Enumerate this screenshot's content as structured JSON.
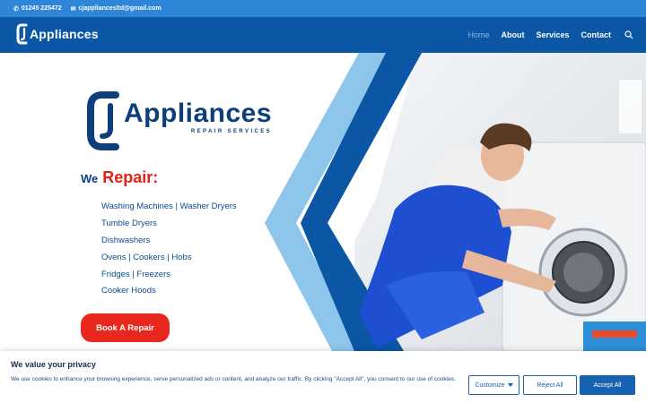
{
  "topbar": {
    "phone": "01245 225472",
    "email": "cjappliancesltd@gmail.com"
  },
  "header": {
    "logo_text": "Appliances",
    "nav": [
      {
        "label": "Home",
        "active": true
      },
      {
        "label": "About",
        "active": false
      },
      {
        "label": "Services",
        "active": false
      },
      {
        "label": "Contact",
        "active": false
      }
    ]
  },
  "hero": {
    "logo_name": "Appliances",
    "logo_tagline": "REPAIR SERVICES",
    "we": "We",
    "repair": "Repair:",
    "services": [
      "Washing Machines | Washer Dryers",
      "Tumble Dryers",
      "Dishwashers",
      "Ovens | Cookers | Hobs",
      "Fridges | Freezers",
      "Cooker Hoods"
    ],
    "cta": "Book A Repair"
  },
  "cookie": {
    "title": "We value your privacy",
    "description": "We use cookies to enhance your browsing experience, serve personalized ads or content, and analyze our traffic. By clicking \"Accept All\", you consent to our use of cookies.",
    "customize": "Customize",
    "reject": "Reject All",
    "accept": "Accept All"
  },
  "colors": {
    "topbar": "#2f86d8",
    "header": "#0b57a6",
    "brand_dark": "#0b3f7e",
    "accent_red": "#e8281c",
    "button_blue": "#1863b1"
  },
  "icons": [
    "phone-icon",
    "mail-icon",
    "search-icon",
    "logo-c-icon",
    "chevron-down-icon"
  ]
}
